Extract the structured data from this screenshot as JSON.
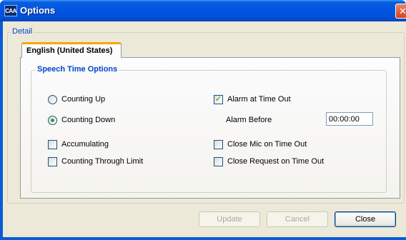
{
  "window": {
    "title": "Options",
    "app_icon_text": "CAA",
    "close_symbol": "✕"
  },
  "detail": {
    "legend": "Detail"
  },
  "tabs": [
    {
      "label": "English (United States)",
      "active": true
    }
  ],
  "speech_options": {
    "legend": "Speech Time Options",
    "counting_up": {
      "label": "Counting Up",
      "selected": false
    },
    "counting_down": {
      "label": "Counting Down",
      "selected": true
    },
    "accumulating": {
      "label": "Accumulating",
      "checked": false
    },
    "counting_through_limit": {
      "label": "Counting Through Limit",
      "checked": false
    },
    "alarm_at_time_out": {
      "label": "Alarm at Time Out",
      "checked": true
    },
    "alarm_before": {
      "label": "Alarm Before",
      "value": "00:00:00"
    },
    "close_mic_on_time_out": {
      "label": "Close Mic on Time Out",
      "checked": false
    },
    "close_request_on_time_out": {
      "label": "Close Request on Time Out",
      "checked": false
    }
  },
  "buttons": {
    "update": {
      "label": "Update",
      "enabled": false
    },
    "cancel": {
      "label": "Cancel",
      "enabled": false
    },
    "close": {
      "label": "Close",
      "enabled": true
    }
  },
  "colors": {
    "titlebar": "#0054e3",
    "group_legend": "#0046d5",
    "tab_highlight": "#f5a600",
    "check_mark": "#21a121"
  },
  "check_mark_symbol": "✓"
}
